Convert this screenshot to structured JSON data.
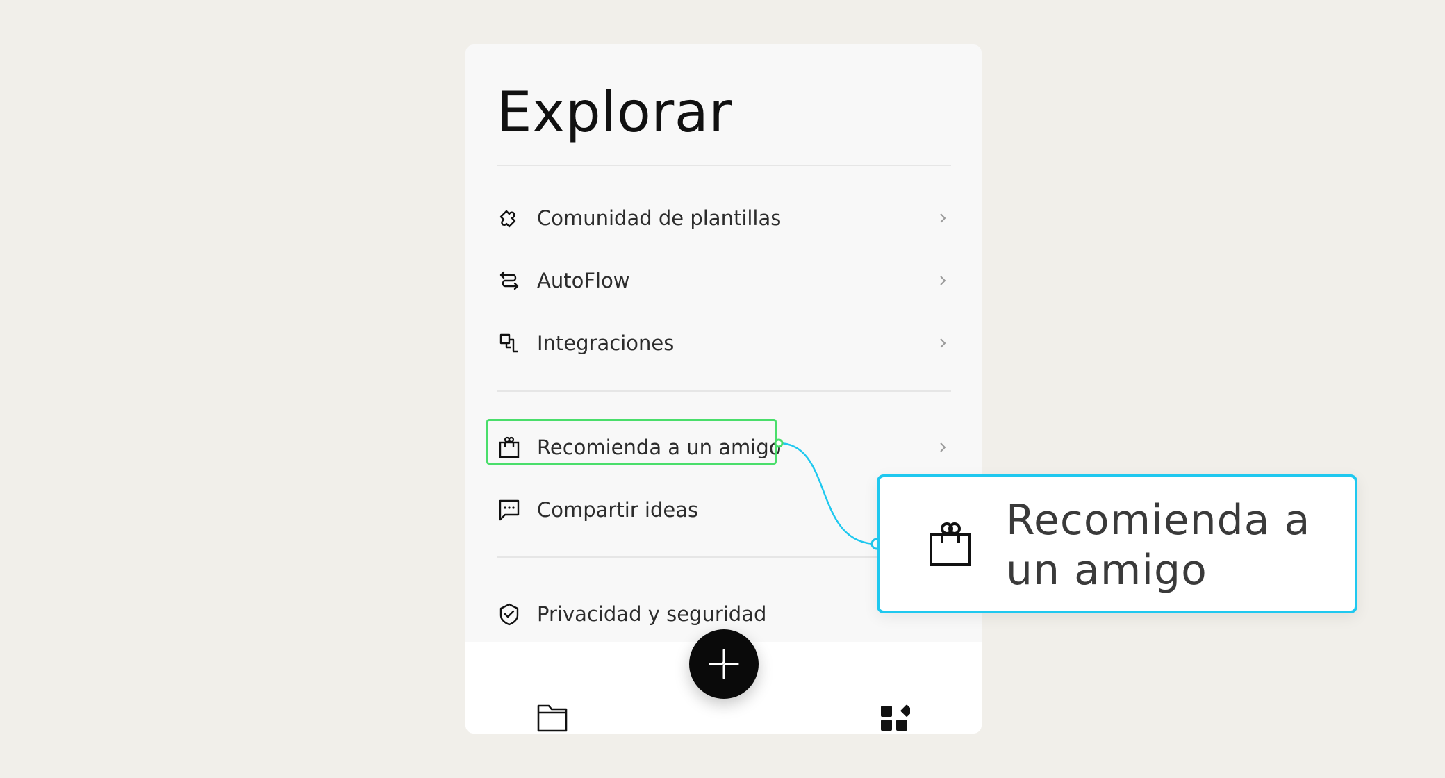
{
  "page": {
    "title": "Explorar"
  },
  "menu": {
    "group1": [
      {
        "label": "Comunidad de plantillas",
        "icon": "puzzle-icon"
      },
      {
        "label": "AutoFlow",
        "icon": "flow-arrows-icon"
      },
      {
        "label": "Integraciones",
        "icon": "integration-blocks-icon"
      }
    ],
    "group2": [
      {
        "label": "Recomienda a un amigo",
        "icon": "gift-bag-icon"
      },
      {
        "label": "Compartir ideas",
        "icon": "chat-bubble-icon"
      }
    ],
    "group3": [
      {
        "label": "Privacidad y seguridad",
        "icon": "shield-check-icon"
      }
    ]
  },
  "bottom_nav": {
    "left_icon": "folder-icon",
    "center_icon": "plus-icon",
    "right_icon": "apps-grid-icon"
  },
  "callout": {
    "label": "Recomienda a un amigo",
    "icon": "gift-bag-icon"
  },
  "colors": {
    "highlight": "#4ade6b",
    "callout_border": "#1fc8ef",
    "fab": "#0a0a0a",
    "background": "#f1efea"
  }
}
